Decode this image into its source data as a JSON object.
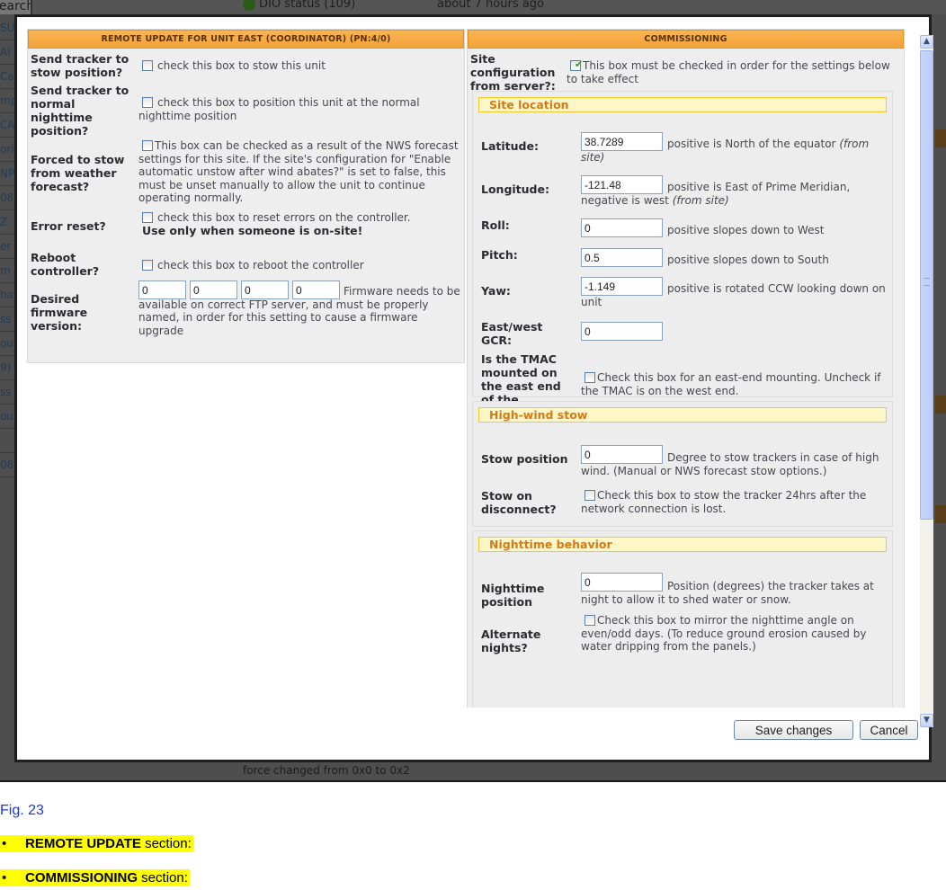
{
  "background": {
    "search_label": "Search",
    "status_text": "DIO status (109)",
    "time_text": "about 7 hours ago",
    "left_items": [
      "SU",
      "Al",
      "Cal",
      "mp",
      "CA",
      "ori",
      "NP",
      "08:",
      "Z",
      "er",
      "m",
      "hat",
      "ss",
      "ou",
      "9)",
      "ss",
      "ou",
      "",
      "08"
    ],
    "bottom_text": "force changed from 0x0 to 0x2"
  },
  "remote_update": {
    "header": "REMOTE UPDATE FOR UNIT EAST (COORDINATOR) (PN:4/0)",
    "rows": [
      {
        "label": "Send tracker to stow position?",
        "checked": false,
        "description": "check this box to stow this unit"
      },
      {
        "label": "Send tracker to normal nighttime position?",
        "checked": false,
        "description": "check this box to position this unit at the normal nighttime position"
      },
      {
        "label": "Forced to stow from weather forecast?",
        "checked": false,
        "description": "This box can be checked as a result of the NWS forecast settings for this site. If the site's configuration for \"Enable automatic unstow after wind abates?\" is set to false, this must be unset manually to allow the unit to continue operating normally."
      },
      {
        "label": "Error reset?",
        "checked": false,
        "description": "check this box to reset errors on the controller.",
        "warning": "Use only when someone is on-site!"
      },
      {
        "label": "Reboot controller?",
        "checked": false,
        "description": "check this box to reboot the controller"
      }
    ],
    "firmware": {
      "label": "Desired firmware version:",
      "values": [
        "0",
        "0",
        "0",
        "0"
      ],
      "description": "Firmware needs to be available on correct FTP server, and must be properly named, in order for this setting to cause a firmware upgrade"
    }
  },
  "commissioning": {
    "header": "COMMISSIONING",
    "site_config": {
      "label": "Site configuration from server?:",
      "checked": true,
      "description": "This box must be checked in order for the settings below to take effect"
    },
    "site_location": {
      "title": "Site location",
      "latitude": {
        "label": "Latitude:",
        "value": "38.7289",
        "description": "positive is North of the equator",
        "note": "(from site)"
      },
      "longitude": {
        "label": "Longitude:",
        "value": "-121.48",
        "description": "positive is East of Prime Meridian, negative is west",
        "note": "(from site)"
      },
      "roll": {
        "label": "Roll:",
        "value": "0",
        "description": "positive slopes down to West"
      },
      "pitch": {
        "label": "Pitch:",
        "value": "0.5",
        "description": "positive slopes down to South"
      },
      "yaw": {
        "label": "Yaw:",
        "value": "-1.149",
        "description": "positive is rotated CCW looking down on unit"
      },
      "gcr": {
        "label": "East/west GCR:",
        "value": "0"
      },
      "tmac": {
        "label": "Is the TMAC mounted on the east end of the tracker?",
        "checked": false,
        "description": "Check this box for an east-end mounting. Uncheck if the TMAC is on the west end."
      }
    },
    "high_wind": {
      "title": "High-wind stow",
      "stow_position": {
        "label": "Stow position",
        "value": "0",
        "description": "Degree to stow trackers in case of high wind. (Manual or NWS forecast stow options.)"
      },
      "stow_disconnect": {
        "label": "Stow on disconnect?",
        "checked": false,
        "description": "Check this box to stow the tracker 24hrs after the network connection is lost."
      }
    },
    "nighttime": {
      "title": "Nighttime behavior",
      "position": {
        "label": "Nighttime position",
        "value": "0",
        "description": "Position (degrees) the tracker takes at night to allow it to shed water or snow."
      },
      "alternate": {
        "label": "Alternate nights?",
        "checked": false,
        "description": "Check this box to mirror the nighttime angle on even/odd days. (To reduce ground erosion caused by water dripping from the panels.)"
      }
    }
  },
  "buttons": {
    "save": "Save changes",
    "cancel": "Cancel"
  },
  "caption": {
    "figure": "Fig. 23",
    "bullets": [
      {
        "bold": "REMOTE UPDATE",
        "rest": " section:"
      },
      {
        "bold": "COMMISSIONING",
        "rest": " section:"
      }
    ]
  },
  "colors": {
    "header_orange": "#f3a13a",
    "subheader_yellow": "#fdf7c7",
    "figure_blue": "#1a37d6",
    "highlight": "#ffff00"
  }
}
